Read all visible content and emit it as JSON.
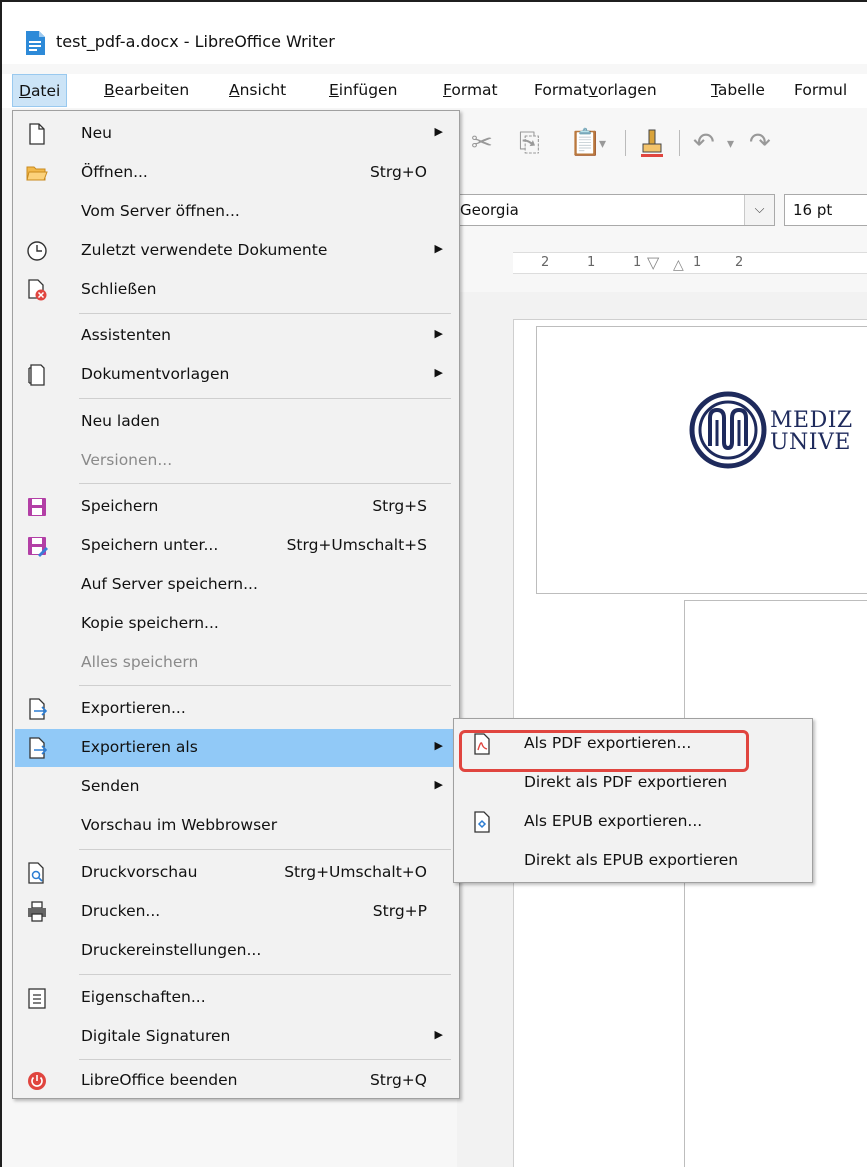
{
  "window": {
    "title": "test_pdf-a.docx - LibreOffice Writer"
  },
  "menubar": {
    "items": [
      "Datei",
      "Bearbeiten",
      "Ansicht",
      "Einfügen",
      "Format",
      "Formatvorlagen",
      "Tabelle",
      "Formul"
    ]
  },
  "toolbar": {
    "font_name": "Georgia",
    "font_size": "16 pt"
  },
  "ruler": {
    "labels": [
      "2",
      "1",
      "1",
      "1",
      "2"
    ]
  },
  "document": {
    "logo_line1": "MEDIZ",
    "logo_line2": "UNIVE"
  },
  "file_menu": {
    "items": [
      {
        "label": "Neu",
        "shortcut": "",
        "submenu": true,
        "icon": "new-document-icon"
      },
      {
        "label": "Öffnen...",
        "shortcut": "Strg+O",
        "submenu": false,
        "icon": "folder-open-icon"
      },
      {
        "label": "Vom Server öffnen...",
        "shortcut": "",
        "submenu": false,
        "icon": ""
      },
      {
        "label": "Zuletzt verwendete Dokumente",
        "shortcut": "",
        "submenu": true,
        "icon": "clock-icon"
      },
      {
        "label": "Schließen",
        "shortcut": "",
        "submenu": false,
        "icon": "close-document-icon"
      },
      {
        "label": "Assistenten",
        "shortcut": "",
        "submenu": true,
        "icon": ""
      },
      {
        "label": "Dokumentvorlagen",
        "shortcut": "",
        "submenu": true,
        "icon": "templates-icon"
      },
      {
        "label": "Neu laden",
        "shortcut": "",
        "submenu": false,
        "icon": ""
      },
      {
        "label": "Versionen...",
        "shortcut": "",
        "submenu": false,
        "icon": "",
        "disabled": true
      },
      {
        "label": "Speichern",
        "shortcut": "Strg+S",
        "submenu": false,
        "icon": "save-icon"
      },
      {
        "label": "Speichern unter...",
        "shortcut": "Strg+Umschalt+S",
        "submenu": false,
        "icon": "save-as-icon"
      },
      {
        "label": "Auf Server speichern...",
        "shortcut": "",
        "submenu": false,
        "icon": ""
      },
      {
        "label": "Kopie speichern...",
        "shortcut": "",
        "submenu": false,
        "icon": ""
      },
      {
        "label": "Alles speichern",
        "shortcut": "",
        "submenu": false,
        "icon": "",
        "disabled": true
      },
      {
        "label": "Exportieren...",
        "shortcut": "",
        "submenu": false,
        "icon": "export-icon"
      },
      {
        "label": "Exportieren als",
        "shortcut": "",
        "submenu": true,
        "icon": "export-as-icon",
        "highlighted": true
      },
      {
        "label": "Senden",
        "shortcut": "",
        "submenu": true,
        "icon": ""
      },
      {
        "label": "Vorschau im Webbrowser",
        "shortcut": "",
        "submenu": false,
        "icon": ""
      },
      {
        "label": "Druckvorschau",
        "shortcut": "Strg+Umschalt+O",
        "submenu": false,
        "icon": "print-preview-icon"
      },
      {
        "label": "Drucken...",
        "shortcut": "Strg+P",
        "submenu": false,
        "icon": "printer-icon"
      },
      {
        "label": "Druckereinstellungen...",
        "shortcut": "",
        "submenu": false,
        "icon": ""
      },
      {
        "label": "Eigenschaften...",
        "shortcut": "",
        "submenu": false,
        "icon": "properties-icon"
      },
      {
        "label": "Digitale Signaturen",
        "shortcut": "",
        "submenu": true,
        "icon": ""
      },
      {
        "label": "LibreOffice beenden",
        "shortcut": "Strg+Q",
        "submenu": false,
        "icon": "power-icon"
      }
    ]
  },
  "export_submenu": {
    "items": [
      {
        "label": "Als PDF exportieren...",
        "icon": "pdf-icon"
      },
      {
        "label": "Direkt als PDF exportieren",
        "icon": ""
      },
      {
        "label": "Als EPUB exportieren...",
        "icon": "epub-icon"
      },
      {
        "label": "Direkt als EPUB exportieren",
        "icon": ""
      }
    ]
  },
  "colors": {
    "highlight": "#91c9f7",
    "callout": "#e0453f",
    "logo": "#1e2a5c"
  }
}
